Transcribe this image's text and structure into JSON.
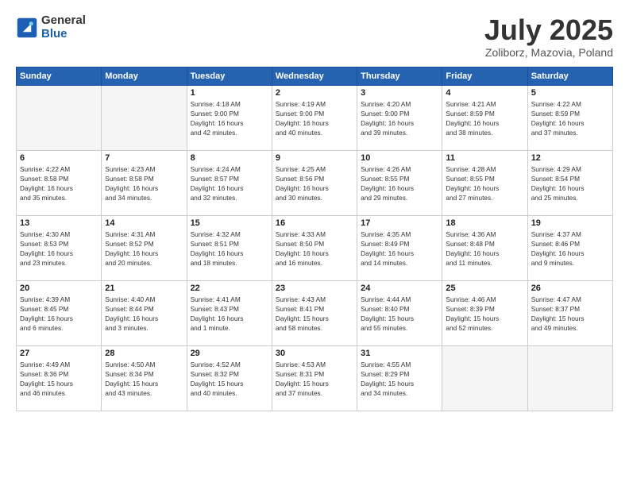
{
  "header": {
    "logo_general": "General",
    "logo_blue": "Blue",
    "title": "July 2025",
    "subtitle": "Zoliborz, Mazovia, Poland"
  },
  "days_of_week": [
    "Sunday",
    "Monday",
    "Tuesday",
    "Wednesday",
    "Thursday",
    "Friday",
    "Saturday"
  ],
  "weeks": [
    [
      {
        "day": "",
        "info": ""
      },
      {
        "day": "",
        "info": ""
      },
      {
        "day": "1",
        "info": "Sunrise: 4:18 AM\nSunset: 9:00 PM\nDaylight: 16 hours\nand 42 minutes."
      },
      {
        "day": "2",
        "info": "Sunrise: 4:19 AM\nSunset: 9:00 PM\nDaylight: 16 hours\nand 40 minutes."
      },
      {
        "day": "3",
        "info": "Sunrise: 4:20 AM\nSunset: 9:00 PM\nDaylight: 16 hours\nand 39 minutes."
      },
      {
        "day": "4",
        "info": "Sunrise: 4:21 AM\nSunset: 8:59 PM\nDaylight: 16 hours\nand 38 minutes."
      },
      {
        "day": "5",
        "info": "Sunrise: 4:22 AM\nSunset: 8:59 PM\nDaylight: 16 hours\nand 37 minutes."
      }
    ],
    [
      {
        "day": "6",
        "info": "Sunrise: 4:22 AM\nSunset: 8:58 PM\nDaylight: 16 hours\nand 35 minutes."
      },
      {
        "day": "7",
        "info": "Sunrise: 4:23 AM\nSunset: 8:58 PM\nDaylight: 16 hours\nand 34 minutes."
      },
      {
        "day": "8",
        "info": "Sunrise: 4:24 AM\nSunset: 8:57 PM\nDaylight: 16 hours\nand 32 minutes."
      },
      {
        "day": "9",
        "info": "Sunrise: 4:25 AM\nSunset: 8:56 PM\nDaylight: 16 hours\nand 30 minutes."
      },
      {
        "day": "10",
        "info": "Sunrise: 4:26 AM\nSunset: 8:55 PM\nDaylight: 16 hours\nand 29 minutes."
      },
      {
        "day": "11",
        "info": "Sunrise: 4:28 AM\nSunset: 8:55 PM\nDaylight: 16 hours\nand 27 minutes."
      },
      {
        "day": "12",
        "info": "Sunrise: 4:29 AM\nSunset: 8:54 PM\nDaylight: 16 hours\nand 25 minutes."
      }
    ],
    [
      {
        "day": "13",
        "info": "Sunrise: 4:30 AM\nSunset: 8:53 PM\nDaylight: 16 hours\nand 23 minutes."
      },
      {
        "day": "14",
        "info": "Sunrise: 4:31 AM\nSunset: 8:52 PM\nDaylight: 16 hours\nand 20 minutes."
      },
      {
        "day": "15",
        "info": "Sunrise: 4:32 AM\nSunset: 8:51 PM\nDaylight: 16 hours\nand 18 minutes."
      },
      {
        "day": "16",
        "info": "Sunrise: 4:33 AM\nSunset: 8:50 PM\nDaylight: 16 hours\nand 16 minutes."
      },
      {
        "day": "17",
        "info": "Sunrise: 4:35 AM\nSunset: 8:49 PM\nDaylight: 16 hours\nand 14 minutes."
      },
      {
        "day": "18",
        "info": "Sunrise: 4:36 AM\nSunset: 8:48 PM\nDaylight: 16 hours\nand 11 minutes."
      },
      {
        "day": "19",
        "info": "Sunrise: 4:37 AM\nSunset: 8:46 PM\nDaylight: 16 hours\nand 9 minutes."
      }
    ],
    [
      {
        "day": "20",
        "info": "Sunrise: 4:39 AM\nSunset: 8:45 PM\nDaylight: 16 hours\nand 6 minutes."
      },
      {
        "day": "21",
        "info": "Sunrise: 4:40 AM\nSunset: 8:44 PM\nDaylight: 16 hours\nand 3 minutes."
      },
      {
        "day": "22",
        "info": "Sunrise: 4:41 AM\nSunset: 8:43 PM\nDaylight: 16 hours\nand 1 minute."
      },
      {
        "day": "23",
        "info": "Sunrise: 4:43 AM\nSunset: 8:41 PM\nDaylight: 15 hours\nand 58 minutes."
      },
      {
        "day": "24",
        "info": "Sunrise: 4:44 AM\nSunset: 8:40 PM\nDaylight: 15 hours\nand 55 minutes."
      },
      {
        "day": "25",
        "info": "Sunrise: 4:46 AM\nSunset: 8:39 PM\nDaylight: 15 hours\nand 52 minutes."
      },
      {
        "day": "26",
        "info": "Sunrise: 4:47 AM\nSunset: 8:37 PM\nDaylight: 15 hours\nand 49 minutes."
      }
    ],
    [
      {
        "day": "27",
        "info": "Sunrise: 4:49 AM\nSunset: 8:36 PM\nDaylight: 15 hours\nand 46 minutes."
      },
      {
        "day": "28",
        "info": "Sunrise: 4:50 AM\nSunset: 8:34 PM\nDaylight: 15 hours\nand 43 minutes."
      },
      {
        "day": "29",
        "info": "Sunrise: 4:52 AM\nSunset: 8:32 PM\nDaylight: 15 hours\nand 40 minutes."
      },
      {
        "day": "30",
        "info": "Sunrise: 4:53 AM\nSunset: 8:31 PM\nDaylight: 15 hours\nand 37 minutes."
      },
      {
        "day": "31",
        "info": "Sunrise: 4:55 AM\nSunset: 8:29 PM\nDaylight: 15 hours\nand 34 minutes."
      },
      {
        "day": "",
        "info": ""
      },
      {
        "day": "",
        "info": ""
      }
    ]
  ]
}
